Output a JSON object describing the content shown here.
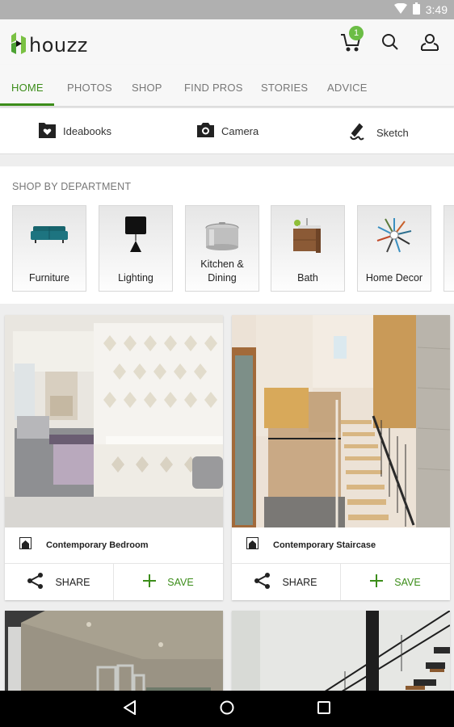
{
  "status_bar": {
    "time": "3:49",
    "icons": [
      "wifi-icon",
      "battery-icon"
    ]
  },
  "app_bar": {
    "logo_text": "houzz",
    "cart_badge": "1",
    "icons": [
      "cart-icon",
      "search-icon",
      "profile-icon"
    ]
  },
  "tabs": [
    {
      "label": "HOME",
      "active": true
    },
    {
      "label": "PHOTOS",
      "active": false
    },
    {
      "label": "SHOP",
      "active": false
    },
    {
      "label": "FIND PROS",
      "active": false
    },
    {
      "label": "STORIES",
      "active": false
    },
    {
      "label": "ADVICE",
      "active": false
    }
  ],
  "quick_actions": [
    {
      "label": "Ideabooks",
      "icon": "ideabook-icon"
    },
    {
      "label": "Camera",
      "icon": "camera-icon"
    },
    {
      "label": "Sketch",
      "icon": "sketch-icon"
    }
  ],
  "shop_by_department": {
    "title": "SHOP BY DEPARTMENT",
    "items": [
      {
        "label": "Furniture",
        "icon": "sofa-icon"
      },
      {
        "label": "Lighting",
        "icon": "lamp-icon"
      },
      {
        "label": "Kitchen & Dining",
        "icon": "pot-icon"
      },
      {
        "label": "Bath",
        "icon": "vanity-icon"
      },
      {
        "label": "Home Decor",
        "icon": "clock-icon"
      }
    ]
  },
  "feed": [
    {
      "title": "Contemporary Bedroom",
      "share_label": "SHARE",
      "save_label": "SAVE"
    },
    {
      "title": "Contemporary Staircase",
      "share_label": "SHARE",
      "save_label": "SAVE"
    },
    {
      "title": "",
      "share_label": "",
      "save_label": ""
    },
    {
      "title": "",
      "share_label": "",
      "save_label": ""
    }
  ],
  "colors": {
    "accent": "#3c8d1a",
    "badge": "#6bbd45",
    "status_bar": "#b0b0b0"
  },
  "nav_bar": {
    "icons": [
      "back-icon",
      "home-icon",
      "recents-icon"
    ]
  }
}
